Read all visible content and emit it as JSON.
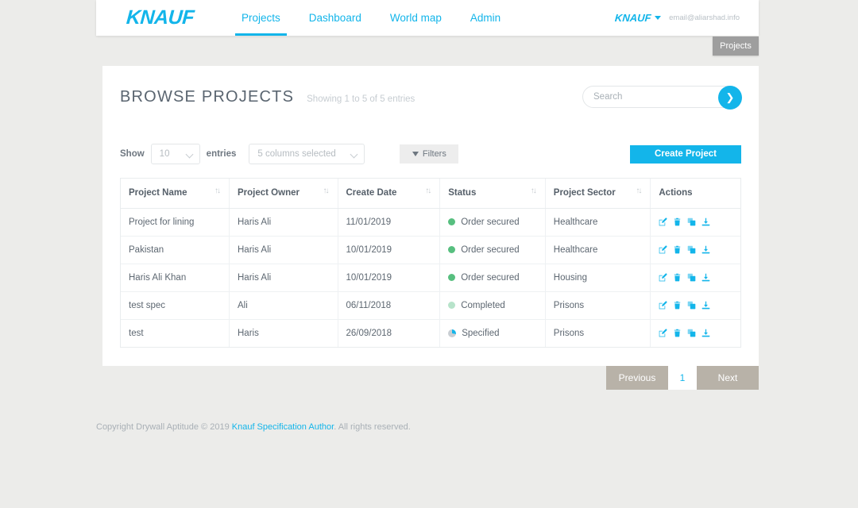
{
  "header": {
    "logo_text": "KNAUF",
    "nav": [
      {
        "label": "Projects",
        "active": true
      },
      {
        "label": "Dashboard",
        "active": false
      },
      {
        "label": "World map",
        "active": false
      },
      {
        "label": "Admin",
        "active": false
      }
    ],
    "user_logo_text": "KNAUF",
    "user_email": "email@aliarshad.info"
  },
  "breadcrumb": {
    "label": "Projects"
  },
  "main": {
    "title": "BROWSE PROJECTS",
    "entries_info": "Showing 1 to 5 of 5 entries",
    "search": {
      "placeholder": "Search",
      "value": "",
      "go_glyph": "❯"
    },
    "controls": {
      "show_label": "Show",
      "page_size": "10",
      "entries_label": "entries",
      "columns_selected": "5 columns selected",
      "filters_label": "Filters",
      "create_label": "Create Project"
    },
    "table": {
      "columns": [
        {
          "label": "Project Name",
          "sortable": true
        },
        {
          "label": "Project Owner",
          "sortable": true
        },
        {
          "label": "Create Date",
          "sortable": true
        },
        {
          "label": "Status",
          "sortable": true
        },
        {
          "label": "Project Sector",
          "sortable": true
        },
        {
          "label": "Actions",
          "sortable": false
        }
      ],
      "sort_glyph": "↑↓",
      "rows": [
        {
          "project_name": "Project for lining",
          "project_owner": "Haris Ali",
          "create_date": "11/01/2019",
          "status": "Order secured",
          "status_type": "dot",
          "status_color": "#57bf7f",
          "project_sector": "Healthcare"
        },
        {
          "project_name": "Pakistan",
          "project_owner": "Haris Ali",
          "create_date": "10/01/2019",
          "status": "Order secured",
          "status_type": "dot",
          "status_color": "#57bf7f",
          "project_sector": "Healthcare"
        },
        {
          "project_name": "Haris Ali Khan",
          "project_owner": "Haris Ali",
          "create_date": "10/01/2019",
          "status": "Order secured",
          "status_type": "dot",
          "status_color": "#57bf7f",
          "project_sector": "Housing"
        },
        {
          "project_name": "test spec",
          "project_owner": "Ali",
          "create_date": "06/11/2018",
          "status": "Completed",
          "status_type": "dot",
          "status_color": "#b7e3ca",
          "project_sector": "Prisons"
        },
        {
          "project_name": "test",
          "project_owner": "Haris",
          "create_date": "26/09/2018",
          "status": "Specified",
          "status_type": "pie",
          "status_color": "#13b5ea",
          "project_sector": "Prisons"
        }
      ],
      "row_actions": [
        {
          "name": "edit-icon",
          "title": "Edit"
        },
        {
          "name": "delete-icon",
          "title": "Delete"
        },
        {
          "name": "copy-icon",
          "title": "Duplicate"
        },
        {
          "name": "download-icon",
          "title": "Download"
        }
      ]
    }
  },
  "pagination": {
    "previous_label": "Previous",
    "current_page": "1",
    "next_label": "Next"
  },
  "footer": {
    "prefix": "Copyright Drywall Aptitude © 2019 ",
    "link": "Knauf Specification Author",
    "suffix": ". All rights reserved."
  },
  "colors": {
    "brand": "#13b5ea",
    "status_secured": "#57bf7f",
    "status_completed": "#b7e3ca",
    "pager": "#b8b2a8"
  }
}
